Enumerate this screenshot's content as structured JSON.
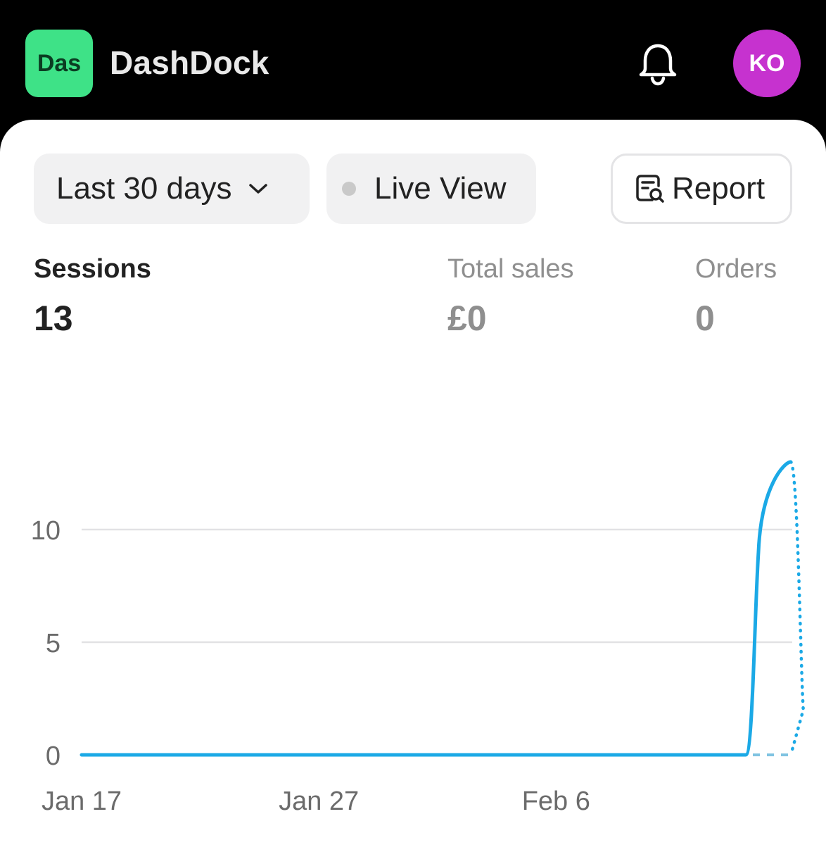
{
  "header": {
    "logo_text": "Das",
    "app_title": "DashDock",
    "avatar_initials": "KO",
    "notification_icon": "bell-icon"
  },
  "colors": {
    "logo_bg": "#3ee287",
    "avatar_bg": "#c632cf",
    "series_line": "#1ba9e6",
    "gridline": "#e2e2e4",
    "live_dot": "#c9c9c9"
  },
  "filters": {
    "date_range_label": "Last 30 days",
    "live_view_label": "Live View",
    "report_label": "Report"
  },
  "metrics": [
    {
      "label": "Sessions",
      "value": "13",
      "selected": true
    },
    {
      "label": "Total sales",
      "value": "£0",
      "selected": false
    },
    {
      "label": "Orders",
      "value": "0",
      "selected": false
    }
  ],
  "chart_data": {
    "type": "line",
    "y_ticks": [
      "0",
      "5",
      "10"
    ],
    "ylim": [
      0,
      13
    ],
    "x_tick_labels": [
      "Jan 17",
      "Jan 27",
      "Feb 6"
    ],
    "x": [
      "Jan 17",
      "Jan 18",
      "Jan 19",
      "Jan 20",
      "Jan 21",
      "Jan 22",
      "Jan 23",
      "Jan 24",
      "Jan 25",
      "Jan 26",
      "Jan 27",
      "Jan 28",
      "Jan 29",
      "Jan 30",
      "Jan 31",
      "Feb 1",
      "Feb 2",
      "Feb 3",
      "Feb 4",
      "Feb 5",
      "Feb 6",
      "Feb 7",
      "Feb 8",
      "Feb 9",
      "Feb 10",
      "Feb 11",
      "Feb 12",
      "Feb 13",
      "Feb 14",
      "Feb 15",
      "Feb 16"
    ],
    "series": [
      {
        "values": [
          0,
          0,
          0,
          0,
          0,
          0,
          0,
          0,
          0,
          0,
          0,
          0,
          0,
          0,
          0,
          0,
          0,
          0,
          0,
          0,
          0,
          0,
          0,
          0,
          0,
          0,
          0,
          0,
          0,
          13
        ],
        "style": "solid"
      },
      {
        "values": [
          null,
          null,
          null,
          null,
          null,
          null,
          null,
          null,
          null,
          null,
          null,
          null,
          null,
          null,
          null,
          null,
          null,
          null,
          null,
          null,
          null,
          null,
          null,
          null,
          null,
          null,
          null,
          null,
          null,
          13,
          0
        ],
        "style": "dotted"
      },
      {
        "values": [
          null,
          null,
          null,
          null,
          null,
          null,
          null,
          null,
          null,
          null,
          null,
          null,
          null,
          null,
          null,
          null,
          null,
          null,
          null,
          null,
          null,
          null,
          null,
          null,
          null,
          null,
          null,
          null,
          0,
          0,
          0
        ],
        "style": "dashed"
      }
    ],
    "grid": true,
    "legend": "none"
  }
}
